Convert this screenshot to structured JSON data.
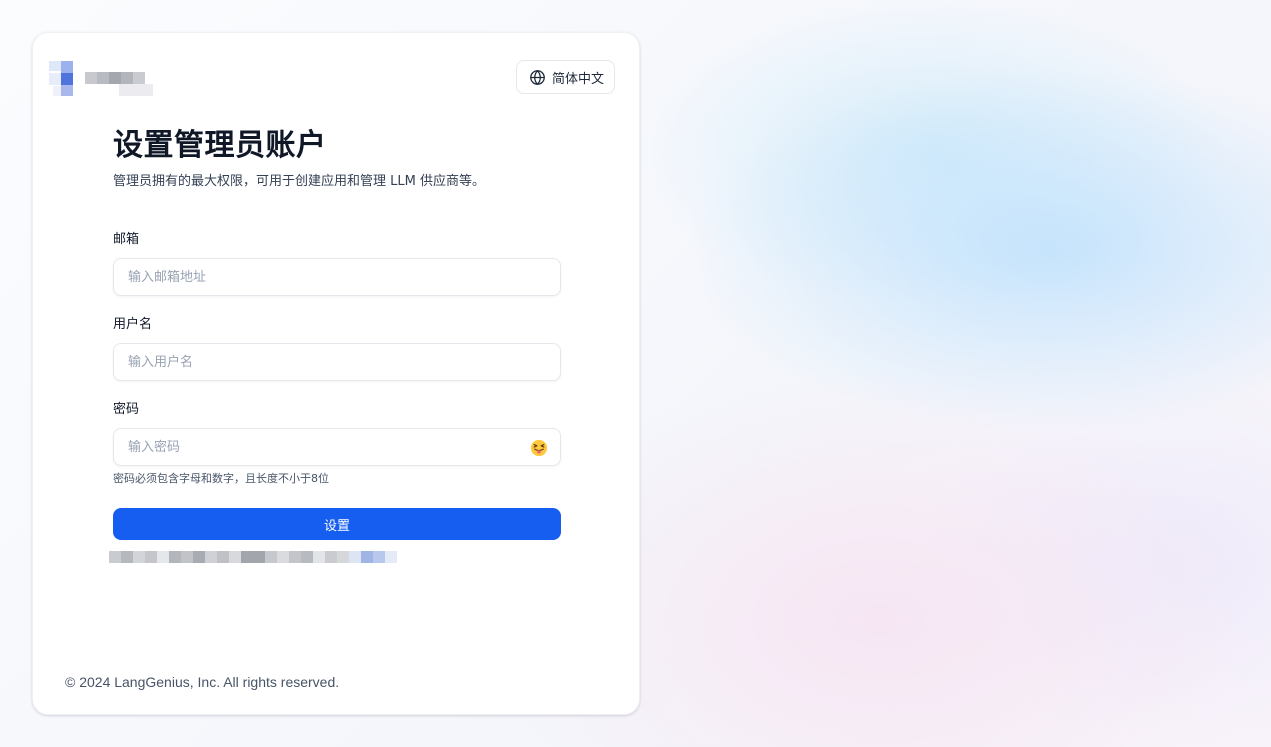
{
  "header": {
    "language_label": "简体中文"
  },
  "form": {
    "title": "设置管理员账户",
    "subtitle": "管理员拥有的最大权限，可用于创建应用和管理 LLM 供应商等。",
    "email": {
      "label": "邮箱",
      "placeholder": "输入邮箱地址",
      "value": ""
    },
    "username": {
      "label": "用户名",
      "placeholder": "输入用户名",
      "value": ""
    },
    "password": {
      "label": "密码",
      "placeholder": "输入密码",
      "value": "",
      "hint": "密码必须包含字母和数字，且长度不小于8位",
      "toggle_icon": "tongue-emoji-icon"
    },
    "submit_label": "设置"
  },
  "footer": {
    "copyright": "© 2024 LangGenius, Inc. All rights reserved."
  },
  "colors": {
    "primary": "#155eef",
    "title": "#101828",
    "muted": "#475467",
    "placeholder": "#98a2b3",
    "border": "#e4e7ec"
  }
}
